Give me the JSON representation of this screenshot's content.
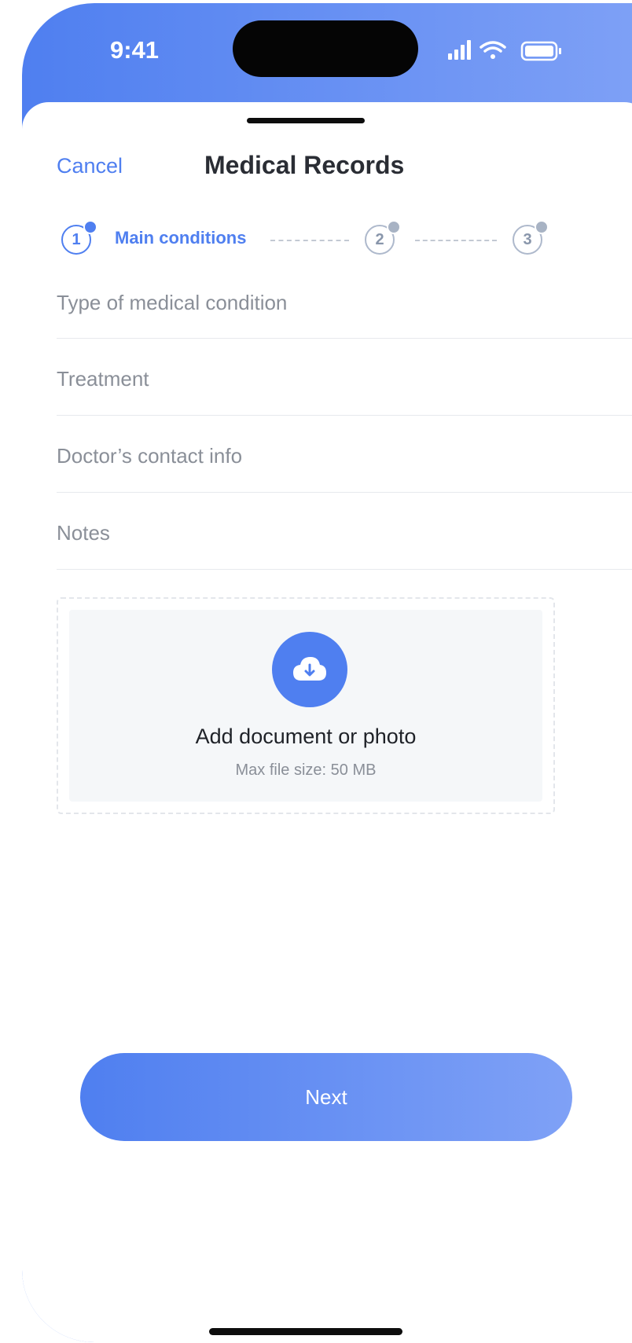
{
  "status_bar": {
    "time": "9:41",
    "icons": [
      "signal-icon",
      "wifi-icon",
      "battery-icon"
    ]
  },
  "header": {
    "cancel_label": "Cancel",
    "title": "Medical Records"
  },
  "stepper": {
    "steps": [
      {
        "number": "1",
        "label": "Main conditions",
        "active": true
      },
      {
        "number": "2",
        "active": false
      },
      {
        "number": "3",
        "active": false
      }
    ]
  },
  "form": {
    "fields": [
      {
        "placeholder": "Type of medical condition"
      },
      {
        "placeholder": "Treatment"
      },
      {
        "placeholder": "Doctor’s contact info"
      },
      {
        "placeholder": "Notes"
      }
    ]
  },
  "upload": {
    "icon": "cloud-download-icon",
    "title": "Add document or photo",
    "subtitle": "Max file size: 50 MB"
  },
  "footer": {
    "next_label": "Next"
  },
  "colors": {
    "accent": "#4f7ff0",
    "accent_light": "#7fa1f6",
    "text_dark": "#2a2d34",
    "placeholder": "#8a8f98"
  }
}
